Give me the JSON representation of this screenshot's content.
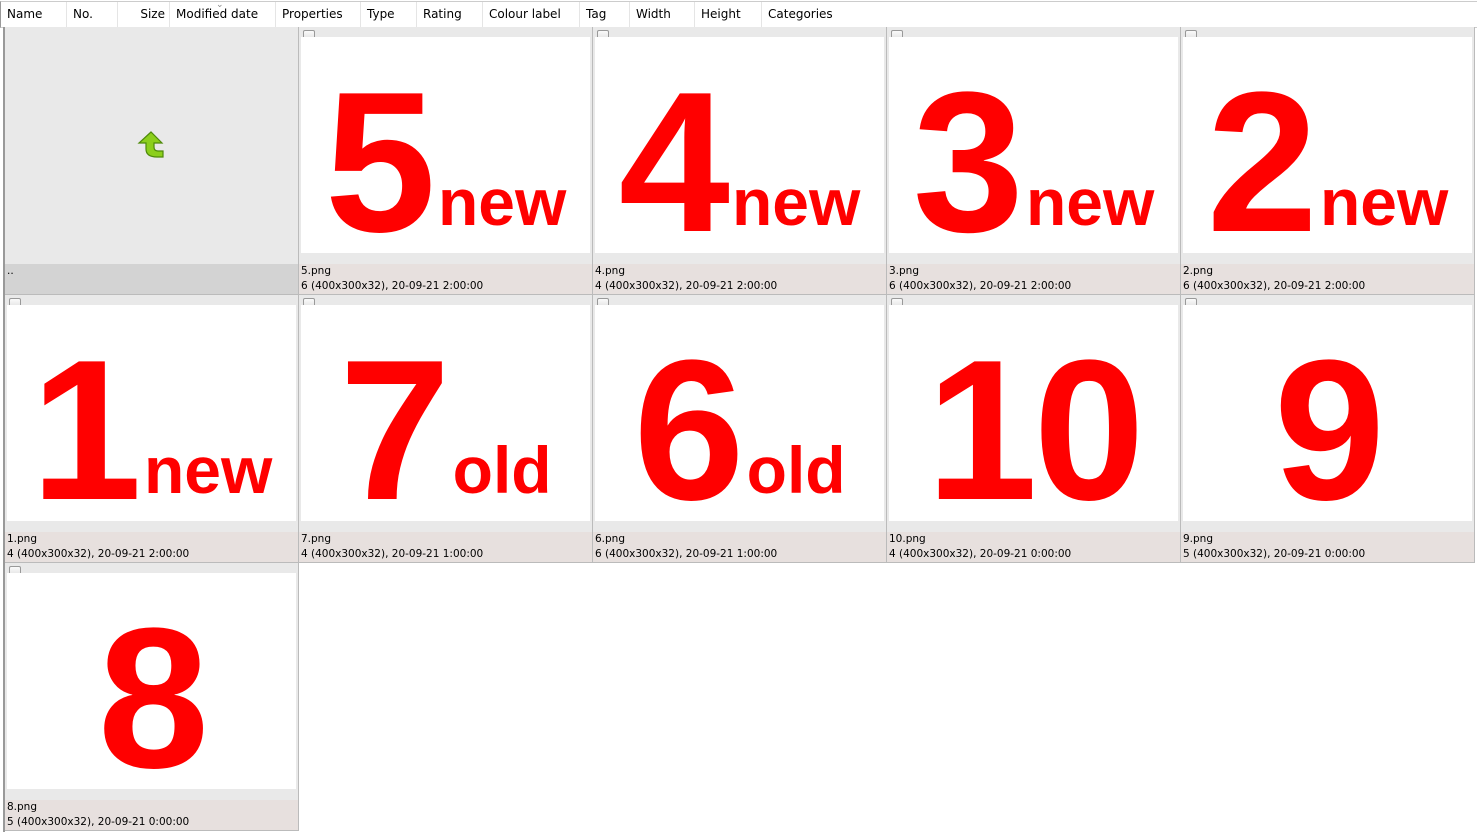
{
  "columns": [
    "Name",
    "No.",
    "Size",
    "Modified date",
    "Properties",
    "Type",
    "Rating",
    "Colour label",
    "Tag",
    "Width",
    "Height",
    "Categories"
  ],
  "parent": {
    "label": ".."
  },
  "tiles": [
    {
      "big": "5",
      "small": "new",
      "name": "5.png",
      "info": "6 (400x300x32), 20-09-21 2:00:00"
    },
    {
      "big": "4",
      "small": "new",
      "name": "4.png",
      "info": "4 (400x300x32), 20-09-21 2:00:00"
    },
    {
      "big": "3",
      "small": "new",
      "name": "3.png",
      "info": "6 (400x300x32), 20-09-21 2:00:00"
    },
    {
      "big": "2",
      "small": "new",
      "name": "2.png",
      "info": "6 (400x300x32), 20-09-21 2:00:00"
    },
    {
      "big": "1",
      "small": "new",
      "name": "1.png",
      "info": "4 (400x300x32), 20-09-21 2:00:00"
    },
    {
      "big": "7",
      "small": "old",
      "name": "7.png",
      "info": "4 (400x300x32), 20-09-21 1:00:00"
    },
    {
      "big": "6",
      "small": "old",
      "name": "6.png",
      "info": "6 (400x300x32), 20-09-21 1:00:00"
    },
    {
      "big": "10",
      "small": "",
      "name": "10.png",
      "info": "4 (400x300x32), 20-09-21 0:00:00"
    },
    {
      "big": "9",
      "small": "",
      "name": "9.png",
      "info": "5 (400x300x32), 20-09-21 0:00:00"
    },
    {
      "big": "8",
      "small": "",
      "name": "8.png",
      "info": "5 (400x300x32), 20-09-21 0:00:00"
    }
  ]
}
